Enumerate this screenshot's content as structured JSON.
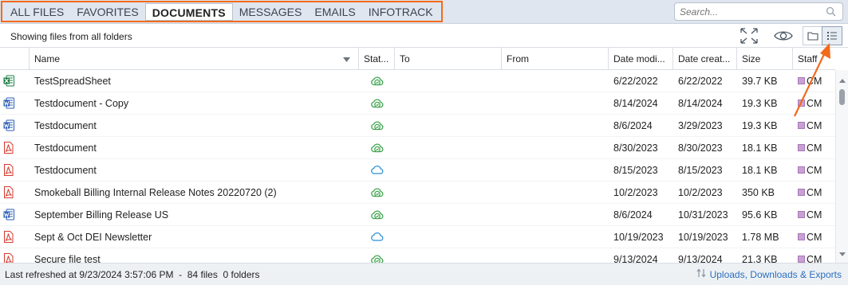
{
  "tabs": [
    {
      "label": "ALL FILES",
      "active": false
    },
    {
      "label": "FAVORITES",
      "active": false
    },
    {
      "label": "DOCUMENTS",
      "active": true
    },
    {
      "label": "MESSAGES",
      "active": false
    },
    {
      "label": "EMAILS",
      "active": false
    },
    {
      "label": "INFOTRACK",
      "active": false
    }
  ],
  "search": {
    "placeholder": "Search..."
  },
  "subbar": {
    "caption": "Showing files from all folders"
  },
  "columns": {
    "name": "Name",
    "status": "Stat...",
    "to": "To",
    "from": "From",
    "date_modified": "Date modi...",
    "date_created": "Date creat...",
    "size": "Size",
    "staff": "Staff"
  },
  "files": [
    {
      "icon": "excel-file-icon",
      "name": "TestSpreadSheet",
      "status": "synced-cloud-icon",
      "date_modified": "6/22/2022",
      "date_created": "6/22/2022",
      "size": "39.7 KB",
      "staff": "CM"
    },
    {
      "icon": "word-file-icon",
      "name": "Testdocument - Copy",
      "status": "synced-cloud-icon",
      "date_modified": "8/14/2024",
      "date_created": "8/14/2024",
      "size": "19.3 KB",
      "staff": "CM"
    },
    {
      "icon": "word-file-icon",
      "name": "Testdocument",
      "status": "synced-cloud-icon",
      "date_modified": "8/6/2024",
      "date_created": "3/29/2023",
      "size": "19.3 KB",
      "staff": "CM"
    },
    {
      "icon": "pdf-file-icon",
      "name": "Testdocument",
      "status": "synced-cloud-icon",
      "date_modified": "8/30/2023",
      "date_created": "8/30/2023",
      "size": "18.1 KB",
      "staff": "CM"
    },
    {
      "icon": "pdf-file-icon",
      "name": "Testdocument",
      "status": "cloud-only-icon",
      "date_modified": "8/15/2023",
      "date_created": "8/15/2023",
      "size": "18.1 KB",
      "staff": "CM"
    },
    {
      "icon": "pdf-file-icon",
      "name": "Smokeball Billing Internal Release Notes 20220720 (2)",
      "status": "synced-cloud-icon",
      "date_modified": "10/2/2023",
      "date_created": "10/2/2023",
      "size": "350 KB",
      "staff": "CM"
    },
    {
      "icon": "word-file-icon",
      "name": "September Billing Release US",
      "status": "synced-cloud-icon",
      "date_modified": "8/6/2024",
      "date_created": "10/31/2023",
      "size": "95.6 KB",
      "staff": "CM"
    },
    {
      "icon": "pdf-file-icon",
      "name": "Sept & Oct DEI Newsletter",
      "status": "cloud-only-icon",
      "date_modified": "10/19/2023",
      "date_created": "10/19/2023",
      "size": "1.78 MB",
      "staff": "CM"
    },
    {
      "icon": "pdf-file-icon",
      "name": "Secure file test",
      "status": "synced-cloud-icon",
      "date_modified": "9/13/2024",
      "date_created": "9/13/2024",
      "size": "21.3 KB",
      "staff": "CM"
    }
  ],
  "footer": {
    "status": "Last refreshed at 9/23/2024 3:57:06 PM  -  84 files  0 folders",
    "link": "Uploads, Downloads & Exports"
  },
  "colors": {
    "highlight": "#f26a1b",
    "tab_bar": "#dfe6ef",
    "link": "#2a6fc0",
    "sync_green": "#3aa24a",
    "cloud_blue": "#2b8fd6"
  }
}
